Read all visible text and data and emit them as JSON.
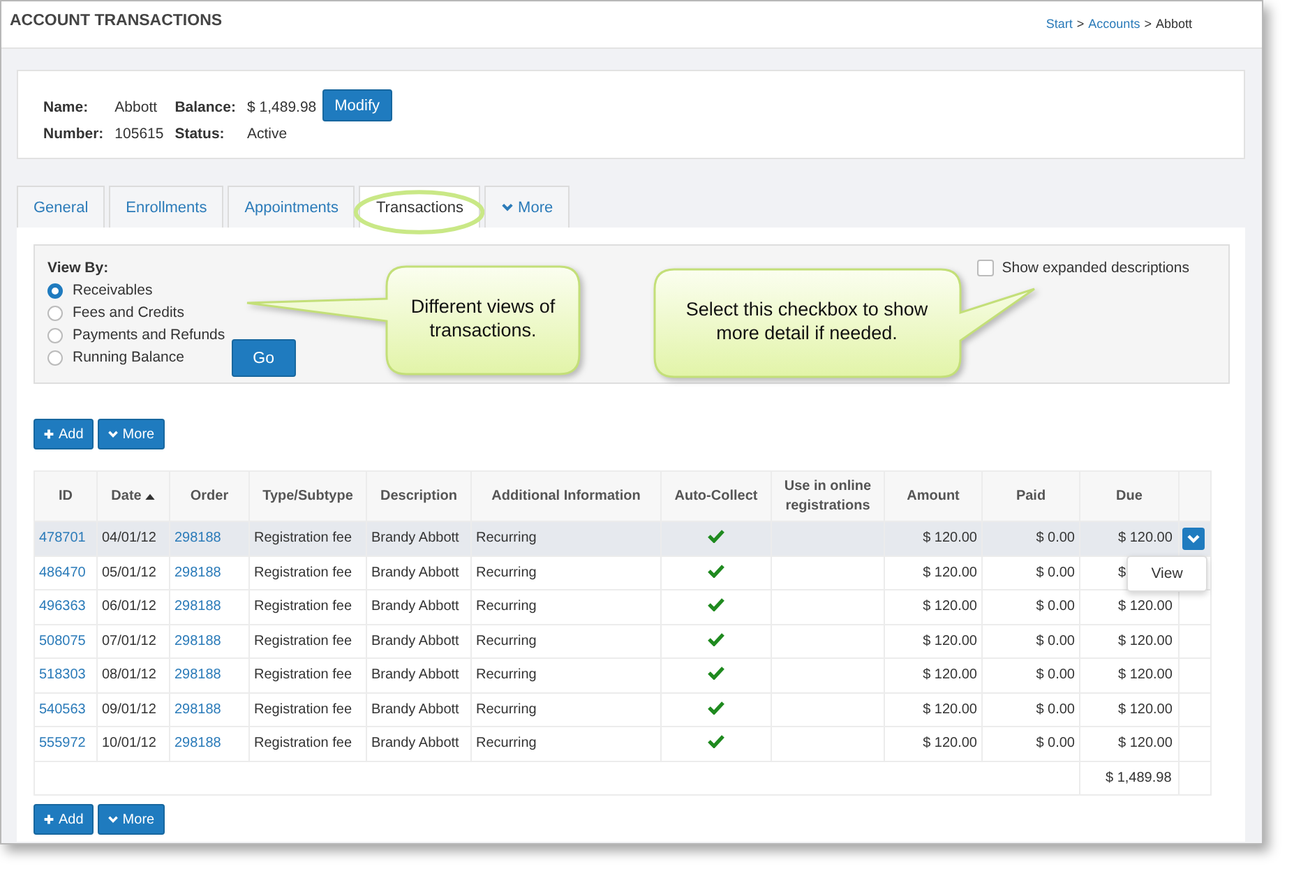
{
  "header": {
    "title": "ACCOUNT TRANSACTIONS",
    "breadcrumb": [
      {
        "label": "Start",
        "link": true
      },
      {
        "label": "Accounts",
        "link": true
      },
      {
        "label": "Abbott",
        "link": false
      }
    ],
    "separator": ">"
  },
  "account": {
    "fields": [
      {
        "label": "Name:",
        "value": "Abbott"
      },
      {
        "label": "Balance:",
        "value": "$ 1,489.98"
      },
      {
        "label": "Number:",
        "value": "105615"
      },
      {
        "label": "Status:",
        "value": "Active"
      }
    ],
    "modify_button": "Modify"
  },
  "tabs": [
    {
      "label": "General",
      "selected": false,
      "circled": false,
      "kind": "plain"
    },
    {
      "label": "Enrollments",
      "selected": false,
      "circled": false,
      "kind": "plain"
    },
    {
      "label": "Appointments",
      "selected": false,
      "circled": false,
      "kind": "plain"
    },
    {
      "label": "Transactions",
      "selected": true,
      "circled": true,
      "kind": "plain"
    },
    {
      "label": "More",
      "selected": false,
      "circled": false,
      "kind": "dropdown"
    }
  ],
  "view_by": {
    "label": "View By:",
    "options": [
      {
        "label": "Receivables",
        "selected": true
      },
      {
        "label": "Fees and Credits",
        "selected": false
      },
      {
        "label": "Payments and Refunds",
        "selected": false
      },
      {
        "label": "Running Balance",
        "selected": false
      }
    ],
    "go_button": "Go"
  },
  "expanded_descriptions": {
    "label": "Show expanded descriptions",
    "checked": false
  },
  "toolbar": [
    {
      "label": "Add",
      "kind": "add"
    },
    {
      "label": "More",
      "kind": "more"
    }
  ],
  "table": {
    "columns": [
      {
        "label": "ID",
        "sorted": false
      },
      {
        "label": "Date",
        "sorted": true
      },
      {
        "label": "Order",
        "sorted": false
      },
      {
        "label": "Type/Subtype",
        "sorted": false
      },
      {
        "label": "Description",
        "sorted": false
      },
      {
        "label": "Additional Information",
        "sorted": false
      },
      {
        "label": "Auto-Collect",
        "sorted": false
      },
      {
        "label": "Use in online registrations",
        "sorted": false
      },
      {
        "label": "Amount",
        "sorted": false
      },
      {
        "label": "Paid",
        "sorted": false
      },
      {
        "label": "Due",
        "sorted": false
      }
    ],
    "rows": [
      {
        "id": "478701",
        "date": "04/01/12",
        "order": "298188",
        "type": "Registration fee",
        "description": "Brandy Abbott",
        "additional": "Recurring",
        "auto_collect": true,
        "amount": "$ 120.00",
        "paid": "$ 0.00",
        "due": "$ 120.00",
        "selected": true,
        "action_button": true
      },
      {
        "id": "486470",
        "date": "05/01/12",
        "order": "298188",
        "type": "Registration fee",
        "description": "Brandy Abbott",
        "additional": "Recurring",
        "auto_collect": true,
        "amount": "$ 120.00",
        "paid": "$ 0.00",
        "due": "$",
        "selected": false,
        "action_button": false
      },
      {
        "id": "496363",
        "date": "06/01/12",
        "order": "298188",
        "type": "Registration fee",
        "description": "Brandy Abbott",
        "additional": "Recurring",
        "auto_collect": true,
        "amount": "$ 120.00",
        "paid": "$ 0.00",
        "due": "$ 120.00",
        "selected": false,
        "action_button": false
      },
      {
        "id": "508075",
        "date": "07/01/12",
        "order": "298188",
        "type": "Registration fee",
        "description": "Brandy Abbott",
        "additional": "Recurring",
        "auto_collect": true,
        "amount": "$ 120.00",
        "paid": "$ 0.00",
        "due": "$ 120.00",
        "selected": false,
        "action_button": false
      },
      {
        "id": "518303",
        "date": "08/01/12",
        "order": "298188",
        "type": "Registration fee",
        "description": "Brandy Abbott",
        "additional": "Recurring",
        "auto_collect": true,
        "amount": "$ 120.00",
        "paid": "$ 0.00",
        "due": "$ 120.00",
        "selected": false,
        "action_button": false
      },
      {
        "id": "540563",
        "date": "09/01/12",
        "order": "298188",
        "type": "Registration fee",
        "description": "Brandy Abbott",
        "additional": "Recurring",
        "auto_collect": true,
        "amount": "$ 120.00",
        "paid": "$ 0.00",
        "due": "$ 120.00",
        "selected": false,
        "action_button": false
      },
      {
        "id": "555972",
        "date": "10/01/12",
        "order": "298188",
        "type": "Registration fee",
        "description": "Brandy Abbott",
        "additional": "Recurring",
        "auto_collect": true,
        "amount": "$ 120.00",
        "paid": "$ 0.00",
        "due": "$ 120.00",
        "selected": false,
        "action_button": false
      }
    ],
    "total": "$ 1,489.98"
  },
  "row_menu": {
    "items": [
      "View"
    ]
  },
  "bottom_toolbar": [
    {
      "label": "Add",
      "kind": "add"
    },
    {
      "label": "More",
      "kind": "more"
    }
  ],
  "callouts": [
    {
      "text": "Different views of transactions.",
      "kind": "left"
    },
    {
      "text": "Select this checkbox to show more detail if needed.",
      "kind": "right"
    }
  ]
}
